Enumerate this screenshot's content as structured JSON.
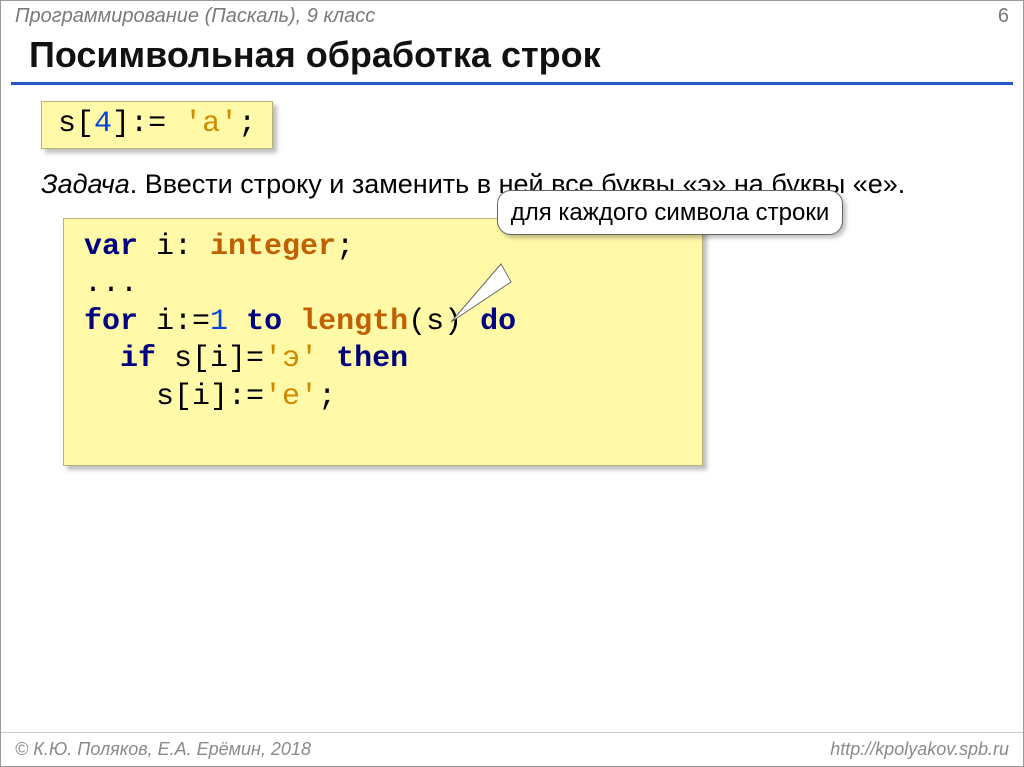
{
  "header": {
    "subject": "Программирование (Паскаль), 9 класс",
    "page": "6"
  },
  "title": "Посимвольная обработка строк",
  "snippet": {
    "s_var": "s",
    "open_bracket": "[",
    "index": "4",
    "close_bracket": "]",
    "assign": ":= ",
    "value": "'a'",
    "semicolon": ";"
  },
  "task": {
    "label": "Задача",
    "text": ". Ввести строку и заменить в ней все буквы «э» на буквы «е»."
  },
  "callout": "для каждого символа строки",
  "code": {
    "l1_kw_var": "var",
    "l1_rest1": " i: ",
    "l1_type": "integer",
    "l1_semi": ";",
    "l2": "...",
    "l3_kw_for": "for",
    "l3_mid1": " i:=",
    "l3_num": "1",
    "l3_mid2": " ",
    "l3_kw_to": "to",
    "l3_mid3": " ",
    "l3_fn": "length",
    "l3_call": "(s) ",
    "l3_kw_do": "do",
    "l4_indent": "  ",
    "l4_kw_if": "if",
    "l4_mid1": " s[i]=",
    "l4_str": "'э'",
    "l4_mid2": " ",
    "l4_kw_then": "then",
    "l5_indent": "    ",
    "l5_lhs": "s[i]:=",
    "l5_str": "'е'",
    "l5_semi": ";"
  },
  "footer": {
    "copyright": "© К.Ю. Поляков, Е.А. Ерёмин, 2018",
    "url": "http://kpolyakov.spb.ru"
  }
}
